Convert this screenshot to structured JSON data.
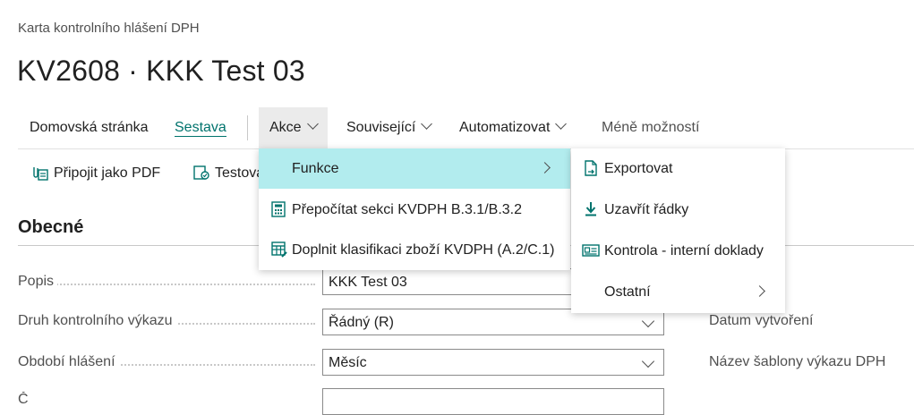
{
  "breadcrumb": "Karta kontrolního hlášení DPH",
  "title": "KV2608 · KKK Test 03",
  "actionbar": {
    "home": "Domovská stránka",
    "report": "Sestava",
    "actions": "Akce",
    "related": "Související",
    "automate": "Automatizovat",
    "fewer": "Méně možností"
  },
  "subbar": {
    "attach_pdf": "Připojit jako PDF",
    "test": "Testova"
  },
  "section": {
    "general": "Obecné"
  },
  "fields": {
    "popis": {
      "label": "Popis",
      "value": "KKK Test 03"
    },
    "druh": {
      "label": "Druh kontrolního výkazu",
      "value": "Řádný (R)"
    },
    "obdobi": {
      "label": "Období hlášení",
      "value": "Měsíc"
    },
    "next": {
      "label": "Č"
    }
  },
  "right_fields": {
    "datum": "Datum vytvoření",
    "sablona": "Název šablony výkazu DPH"
  },
  "menu_akce": [
    {
      "label": "Funkce"
    },
    {
      "label": "Přepočítat sekci KVDPH B.3.1/B.3.2"
    },
    {
      "label": "Doplnit klasifikaci zboží KVDPH (A.2/C.1)"
    }
  ],
  "menu_funkce": [
    {
      "label": "Exportovat"
    },
    {
      "label": "Uzavřít řádky"
    },
    {
      "label": "Kontrola - interní doklady"
    },
    {
      "label": "Ostatní"
    }
  ],
  "colors": {
    "accent": "#00736d",
    "highlight": "#b2ecee",
    "hover": "#ebebeb"
  }
}
